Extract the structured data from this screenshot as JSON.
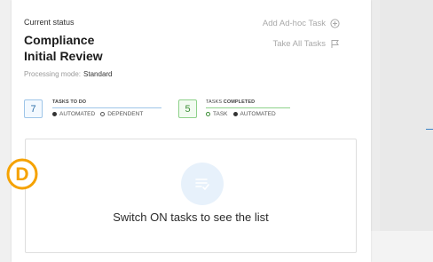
{
  "panel": {
    "status_label": "Current status",
    "title_line1": "Compliance",
    "title_line2": "Initial Review",
    "mode_label": "Processing mode:",
    "mode_value": "Standard",
    "actions": {
      "add_adhoc": "Add Ad-hoc Task",
      "take_all": "Take All Tasks"
    }
  },
  "stats": {
    "todo": {
      "count": "7",
      "header": "TASKS TO DO",
      "legend": [
        "AUTOMATED",
        "DEPENDENT"
      ]
    },
    "completed": {
      "count": "5",
      "header_a": "TASKS ",
      "header_b": "COMPLETED",
      "legend": [
        "TASK",
        "AUTOMATED"
      ]
    }
  },
  "empty_state": {
    "message": "Switch ON tasks to see the list",
    "icon": "task-list-icon"
  },
  "overlay_badge": {
    "letter": "D",
    "color": "#f5a200"
  },
  "colors": {
    "blue_accent": "#9ec5e8",
    "green_accent": "#8ed18a",
    "icon_circle": "#e7f1fb"
  }
}
